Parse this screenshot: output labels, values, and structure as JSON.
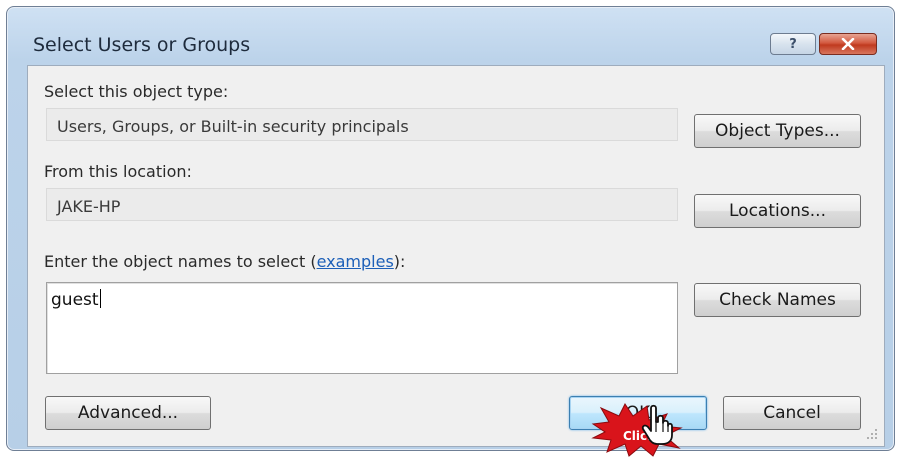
{
  "window": {
    "title": "Select Users or Groups",
    "help_glyph": "?",
    "close_icon": "close-icon"
  },
  "object_type": {
    "label": "Select this object type:",
    "value": "Users, Groups, or Built-in security principals",
    "button": "Object Types..."
  },
  "location": {
    "label": "From this location:",
    "value": "JAKE-HP",
    "button": "Locations..."
  },
  "names": {
    "label_prefix": "Enter the object names to select (",
    "link": "examples",
    "label_suffix": "):",
    "value": "guest",
    "check_button": "Check Names"
  },
  "footer": {
    "advanced_button": "Advanced...",
    "ok_button": "OK",
    "cancel_button": "Cancel"
  },
  "annotation": {
    "click_label": "Click",
    "colors": {
      "burst": "#d9141b",
      "link": "#1c5fb8"
    }
  }
}
